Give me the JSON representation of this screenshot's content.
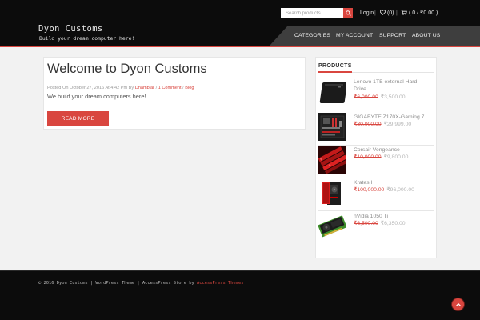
{
  "site": {
    "title": "Dyon Customs",
    "tagline": "Build your dream computer here!"
  },
  "header": {
    "search_placeholder": "Search products",
    "login_label": "Login",
    "wishlist_label": "(0)",
    "cart_label": "( 0 / ₹0.00 )",
    "nav": [
      "CATEGORIES",
      "MY ACCOUNT",
      "SUPPORT",
      "ABOUT US"
    ]
  },
  "post": {
    "title": "Welcome to Dyon Customs",
    "meta_prefix": "Posted On October 27, 2016 At 4:42 Pm By ",
    "author": "Dnamblar",
    "comments": "1 Comment",
    "category": "Blog",
    "excerpt": "We build your dream computers here!",
    "read_more": "READ MORE"
  },
  "sidebar": {
    "title": "PRODUCTS",
    "products": [
      {
        "name": "Lenovo 1TB external Hard Drive",
        "name_line1": "Lenovo 1TB external Hard",
        "name_line2": "Drive",
        "old_price": "₹6,000.00",
        "new_price": "₹3,500.00"
      },
      {
        "name": "GIGABYTE Z170X-Gaming 7",
        "name_line1": "GIGABYTE Z170X-Gaming 7",
        "name_line2": "",
        "old_price": "₹30,000.00",
        "new_price": "₹29,999.00"
      },
      {
        "name": "Corsair Vengeance",
        "name_line1": "Corsair Vengeance",
        "name_line2": "",
        "old_price": "₹10,000.00",
        "new_price": "₹9,800.00"
      },
      {
        "name": "Krates I",
        "name_line1": "Krates I",
        "name_line2": "",
        "old_price": "₹100,000.00",
        "new_price": "₹96,000.00"
      },
      {
        "name": "nVidia 1050 Ti",
        "name_line1": "nVidia 1050 Ti",
        "name_line2": "",
        "old_price": "₹6,500.00",
        "new_price": "₹6,350.00"
      }
    ]
  },
  "footer": {
    "copyright": "© 2016 Dyon Customs",
    "wordpress_text": "WordPress Theme",
    "theme_text": "AccessPress Store by",
    "theme_author": "AccessPress Themes"
  },
  "colors": {
    "accent": "#d9463f",
    "header_bg": "#0c0c0c",
    "nav_bg": "#3e3e3e",
    "page_bg": "#f2f2f2"
  }
}
